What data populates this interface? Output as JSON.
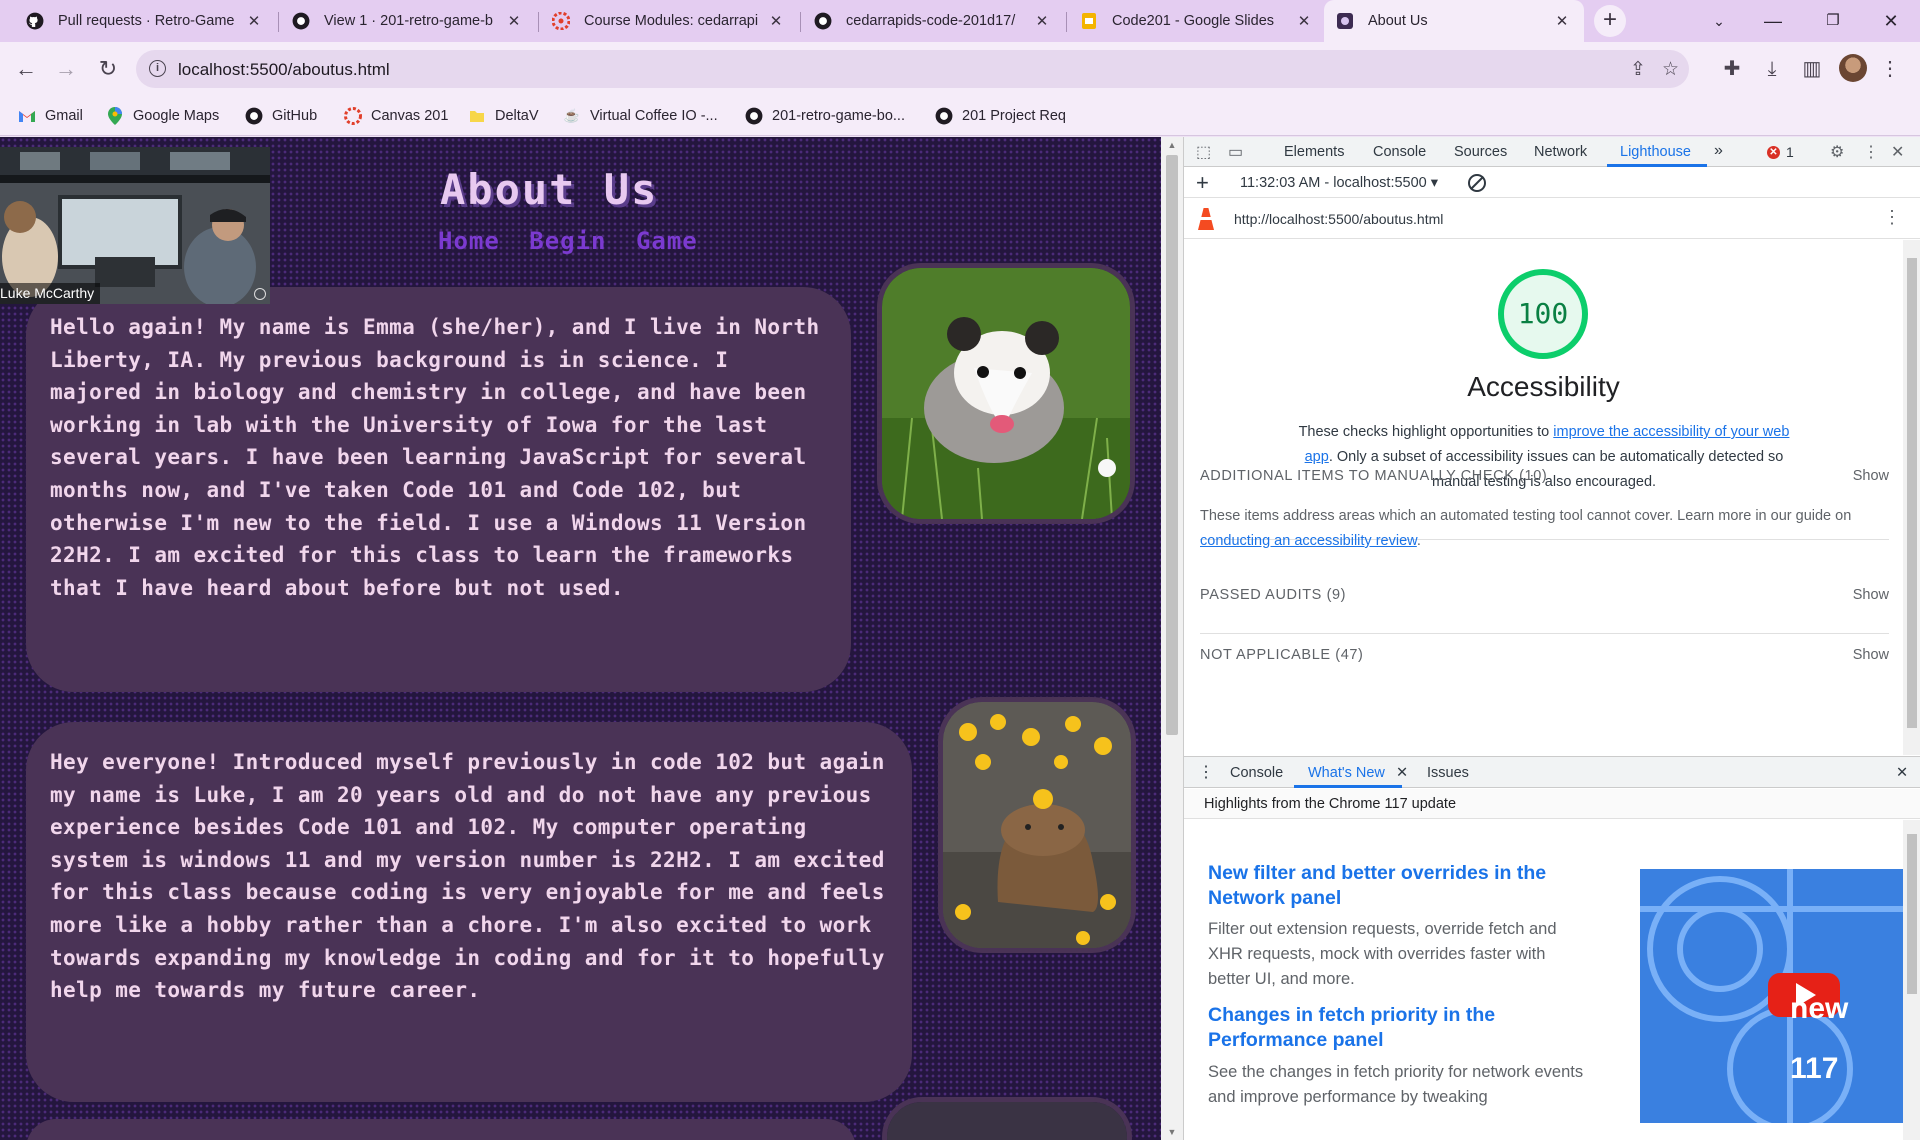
{
  "browser": {
    "tabs": [
      {
        "title": "Pull requests · Retro-Game",
        "icon": "github-icon"
      },
      {
        "title": "View 1 · 201-retro-game-b",
        "icon": "github-icon"
      },
      {
        "title": "Course Modules: cedarrapi",
        "icon": "canvas-icon"
      },
      {
        "title": "cedarrapids-code-201d17/",
        "icon": "github-icon"
      },
      {
        "title": "Code201 - Google Slides",
        "icon": "slides-icon"
      },
      {
        "title": "About Us",
        "icon": "page-icon",
        "active": true
      }
    ],
    "address": "localhost:5500/aboutus.html",
    "bookmarks": [
      {
        "label": "Gmail",
        "icon": "gmail-icon"
      },
      {
        "label": "Google Maps",
        "icon": "maps-icon"
      },
      {
        "label": "GitHub",
        "icon": "github-icon"
      },
      {
        "label": "Canvas 201",
        "icon": "canvas-icon"
      },
      {
        "label": "DeltaV",
        "icon": "folder-icon"
      },
      {
        "label": "Virtual Coffee IO -...",
        "icon": "coffee-icon"
      },
      {
        "label": "201-retro-game-bo...",
        "icon": "github-icon"
      },
      {
        "label": "201 Project Req",
        "icon": "github-icon"
      }
    ]
  },
  "page": {
    "heading": "About Us",
    "nav": [
      "Home",
      "Begin",
      "Game"
    ],
    "bios": [
      "Hello again! My name is Emma (she/her), and I live in North Liberty, IA. My previous background is in science. I majored in biology and chemistry in college, and have been working in lab with the University of Iowa for the last several years. I have been learning JavaScript for several months now, and I've taken Code 101 and Code 102, but otherwise I'm new to the field. I use a Windows 11 Version 22H2. I am excited for this class to learn the frameworks that I have heard about before but not used.",
      "Hey everyone! Introduced myself previously in code 102 but again my name is Luke, I am 20 years old and do not have any previous experience besides Code 101 and 102. My computer operating system is windows 11 and my version number is 22H2. I am excited for this class because coding is very enjoyable for me and feels more like a hobby rather than a chore. I'm also excited to work towards expanding my knowledge in coding and for it to hopefully help me towards my future career."
    ],
    "video_caption": "Luke McCarthy"
  },
  "devtools": {
    "tabs": [
      "Elements",
      "Console",
      "Sources",
      "Network",
      "Lighthouse"
    ],
    "active_tab": "Lighthouse",
    "error_count": "1",
    "report_label": "11:32:03 AM - localhost:5500",
    "report_url": "http://localhost:5500/aboutus.html",
    "score": "100",
    "category": "Accessibility",
    "desc_pre": "These checks highlight opportunities to ",
    "desc_link": "improve the accessibility of your web app",
    "desc_post": ". Only a subset of accessibility issues can be automatically detected so manual testing is also encouraged.",
    "groups": [
      {
        "title": "ADDITIONAL ITEMS TO MANUALLY CHECK (10)",
        "show": "Show"
      },
      {
        "title": "PASSED AUDITS (9)",
        "show": "Show"
      },
      {
        "title": "NOT APPLICABLE (47)",
        "show": "Show"
      }
    ],
    "manual_desc_pre": "These items address areas which an automated testing tool cannot cover. Learn more in our guide on ",
    "manual_desc_link": "conducting an accessibility review",
    "manual_desc_post": ".",
    "drawer_tabs": [
      "Console",
      "What's New",
      "Issues"
    ],
    "whatsnew_header": "Highlights from the Chrome 117 update",
    "whatsnew_items": [
      {
        "title": "New filter and better overrides in the Network panel",
        "desc": "Filter out extension requests, override fetch and XHR requests, mock with overrides faster with better UI, and more."
      },
      {
        "title": "Changes in fetch priority in the Performance panel",
        "desc": "See the changes in fetch priority for network events and improve performance by tweaking"
      }
    ],
    "video_text": "new 117",
    "colors": {
      "accent": "#1a73e8",
      "score": "#0cce6b",
      "error": "#d93025"
    }
  }
}
